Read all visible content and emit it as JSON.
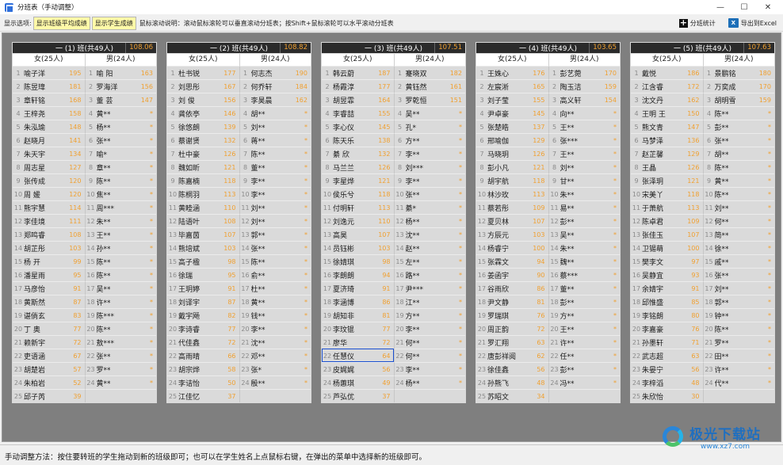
{
  "window": {
    "title": "分班表（手动调整）",
    "buttons": [
      "—",
      "☐",
      "✕"
    ]
  },
  "toolbar": {
    "label": "显示选项:",
    "btn_avg": "显示班级平均成绩",
    "btn_score": "显示学生成绩",
    "tip": "鼠标滚动说明：滚动鼠标滚轮可以垂直滚动分班表；按Shift+鼠标滚轮可以水平滚动分班表",
    "stats_label": "分班统计",
    "export_label": "导出到Excel",
    "excel_icon_text": "X"
  },
  "status": {
    "text": "手动调整方法：按住要转班的学生拖动到新的班级即可；也可以在学生姓名上点鼠标右键，在弹出的菜单中选择新的班级即可。"
  },
  "watermark": {
    "name": "极光下载站",
    "url": "www.xz7.com"
  },
  "colors": {
    "score": "#f0a030",
    "header_bg": "#2b2b2b",
    "selection": "#1a4fd0",
    "button_bg": "#fff9a8"
  },
  "classes": [
    {
      "name": "一 (1) 班(共49人)",
      "avg": "108.06",
      "female_head": "女(25人)",
      "male_head": "男(24人)",
      "rows": [
        {
          "n": "1",
          "f": "喻子洋",
          "fs": "195",
          "m": "喻 阳",
          "ms": "163"
        },
        {
          "n": "2",
          "f": "陈昱瑋",
          "fs": "181",
          "m": "罗海洋",
          "ms": "156"
        },
        {
          "n": "3",
          "f": "章轩铭",
          "fs": "168",
          "m": "董 芸",
          "ms": "147"
        },
        {
          "n": "4",
          "f": "王梓尧",
          "fs": "158",
          "m": "黄**",
          "ms": "*"
        },
        {
          "n": "5",
          "f": "朱泓瑜",
          "fs": "148",
          "m": "杨**",
          "ms": "*"
        },
        {
          "n": "6",
          "f": "赵晓月",
          "fs": "141",
          "m": "张**",
          "ms": "*"
        },
        {
          "n": "7",
          "f": "朱天宇",
          "fs": "134",
          "m": "喻*",
          "ms": "*"
        },
        {
          "n": "8",
          "f": "周志星",
          "fs": "127",
          "m": "章**",
          "ms": "*"
        },
        {
          "n": "9",
          "f": "张传成",
          "fs": "120",
          "m": "陈**",
          "ms": "*"
        },
        {
          "n": "10",
          "f": "周 媛",
          "fs": "120",
          "m": "焦**",
          "ms": "*"
        },
        {
          "n": "11",
          "f": "熊宇慧",
          "fs": "114",
          "m": "周***",
          "ms": "*"
        },
        {
          "n": "12",
          "f": "李佳境",
          "fs": "111",
          "m": "朱**",
          "ms": "*"
        },
        {
          "n": "13",
          "f": "郑鸣睿",
          "fs": "108",
          "m": "王**",
          "ms": "*"
        },
        {
          "n": "14",
          "f": "胡芷彤",
          "fs": "103",
          "m": "孙**",
          "ms": "*"
        },
        {
          "n": "15",
          "f": "杨 开",
          "fs": "99",
          "m": "陈**",
          "ms": "*"
        },
        {
          "n": "16",
          "f": "潘星雨",
          "fs": "95",
          "m": "陈**",
          "ms": "*"
        },
        {
          "n": "17",
          "f": "马彦怡",
          "fs": "91",
          "m": "吴**",
          "ms": "*"
        },
        {
          "n": "18",
          "f": "黄斯然",
          "fs": "87",
          "m": "许**",
          "ms": "*"
        },
        {
          "n": "19",
          "f": "谌倘玄",
          "fs": "83",
          "m": "陈***",
          "ms": "*"
        },
        {
          "n": "20",
          "f": "丁 奥",
          "fs": "77",
          "m": "陈**",
          "ms": "*"
        },
        {
          "n": "21",
          "f": "赖新宇",
          "fs": "72",
          "m": "敖***",
          "ms": "*"
        },
        {
          "n": "22",
          "f": "吏语涵",
          "fs": "67",
          "m": "张**",
          "ms": "*"
        },
        {
          "n": "23",
          "f": "胡楚岩",
          "fs": "57",
          "m": "罗**",
          "ms": "*"
        },
        {
          "n": "24",
          "f": "朱柏岩",
          "fs": "52",
          "m": "黄**",
          "ms": "*"
        },
        {
          "n": "25",
          "f": "邱子芮",
          "fs": "39",
          "m": "",
          "ms": ""
        }
      ]
    },
    {
      "name": "一 (2) 班(共49人)",
      "avg": "108.82",
      "female_head": "女(25人)",
      "male_head": "男(24人)",
      "rows": [
        {
          "n": "1",
          "f": "杜书锐",
          "fs": "177",
          "m": "何志杰",
          "ms": "190"
        },
        {
          "n": "2",
          "f": "刘思彤",
          "fs": "167",
          "m": "何乔轩",
          "ms": "184"
        },
        {
          "n": "3",
          "f": "刘 俊",
          "fs": "156",
          "m": "李昊晨",
          "ms": "162"
        },
        {
          "n": "4",
          "f": "龚依亭",
          "fs": "146",
          "m": "胡**",
          "ms": "*"
        },
        {
          "n": "5",
          "f": "徐悠朗",
          "fs": "139",
          "m": "刘**",
          "ms": "*"
        },
        {
          "n": "6",
          "f": "蔡谢贤",
          "fs": "132",
          "m": "蒋**",
          "ms": "*"
        },
        {
          "n": "7",
          "f": "杜中豪",
          "fs": "126",
          "m": "陈**",
          "ms": "*"
        },
        {
          "n": "8",
          "f": "魏如昕",
          "fs": "121",
          "m": "董**",
          "ms": "*"
        },
        {
          "n": "9",
          "f": "陈嘉楠",
          "fs": "118",
          "m": "李**",
          "ms": "*"
        },
        {
          "n": "10",
          "f": "陈桐羽",
          "fs": "113",
          "m": "李**",
          "ms": "*"
        },
        {
          "n": "11",
          "f": "黄睦涵",
          "fs": "110",
          "m": "刘**",
          "ms": "*"
        },
        {
          "n": "12",
          "f": "陆语叶",
          "fs": "108",
          "m": "刘**",
          "ms": "*"
        },
        {
          "n": "13",
          "f": "毕嘉茵",
          "fs": "107",
          "m": "郭**",
          "ms": "*"
        },
        {
          "n": "14",
          "f": "熊培斌",
          "fs": "103",
          "m": "张**",
          "ms": "*"
        },
        {
          "n": "15",
          "f": "高子楹",
          "fs": "98",
          "m": "陈**",
          "ms": "*"
        },
        {
          "n": "16",
          "f": "徐瑞",
          "fs": "95",
          "m": "俞**",
          "ms": "*"
        },
        {
          "n": "17",
          "f": "王玥婷",
          "fs": "91",
          "m": "杜**",
          "ms": "*"
        },
        {
          "n": "18",
          "f": "刘译宇",
          "fs": "87",
          "m": "黄**",
          "ms": "*"
        },
        {
          "n": "19",
          "f": "戴宇飏",
          "fs": "82",
          "m": "钱**",
          "ms": "*"
        },
        {
          "n": "20",
          "f": "李诗睿",
          "fs": "77",
          "m": "李**",
          "ms": "*"
        },
        {
          "n": "21",
          "f": "代佳鑫",
          "fs": "72",
          "m": "沈**",
          "ms": "*"
        },
        {
          "n": "22",
          "f": "高雨晴",
          "fs": "66",
          "m": "邓**",
          "ms": "*"
        },
        {
          "n": "23",
          "f": "胡宗烨",
          "fs": "58",
          "m": "张*",
          "ms": "*"
        },
        {
          "n": "24",
          "f": "李诘怡",
          "fs": "50",
          "m": "殷**",
          "ms": "*"
        },
        {
          "n": "25",
          "f": "江佳忆",
          "fs": "37",
          "m": "",
          "ms": ""
        }
      ]
    },
    {
      "name": "一 (3) 班(共49人)",
      "avg": "107.51",
      "female_head": "女(25人)",
      "male_head": "男(24人)",
      "rows": [
        {
          "n": "1",
          "f": "韩云蔚",
          "fs": "187",
          "m": "蹇晓双",
          "ms": "182"
        },
        {
          "n": "2",
          "f": "杨霞淳",
          "fs": "177",
          "m": "黄钰然",
          "ms": "161"
        },
        {
          "n": "3",
          "f": "胡昱霏",
          "fs": "164",
          "m": "罗乾恒",
          "ms": "151"
        },
        {
          "n": "4",
          "f": "李睿喆",
          "fs": "155",
          "m": "吴**",
          "ms": "*"
        },
        {
          "n": "5",
          "f": "李心仪",
          "fs": "145",
          "m": "孔*",
          "ms": "*"
        },
        {
          "n": "6",
          "f": "陈天乐",
          "fs": "138",
          "m": "方**",
          "ms": "*"
        },
        {
          "n": "7",
          "f": "綦 欣",
          "fs": "132",
          "m": "李**",
          "ms": "*"
        },
        {
          "n": "8",
          "f": "马兰兰",
          "fs": "126",
          "m": "刘***",
          "ms": "*"
        },
        {
          "n": "9",
          "f": "李星烨",
          "fs": "121",
          "m": "李**",
          "ms": "*"
        },
        {
          "n": "10",
          "f": "侯乐兮",
          "fs": "118",
          "m": "张**",
          "ms": "*"
        },
        {
          "n": "11",
          "f": "付明轩",
          "fs": "113",
          "m": "綦*",
          "ms": "*"
        },
        {
          "n": "12",
          "f": "刘逸元",
          "fs": "110",
          "m": "杨**",
          "ms": "*"
        },
        {
          "n": "13",
          "f": "高昊",
          "fs": "107",
          "m": "沈**",
          "ms": "*"
        },
        {
          "n": "14",
          "f": "员钰彬",
          "fs": "103",
          "m": "赵**",
          "ms": "*"
        },
        {
          "n": "15",
          "f": "徐婧琪",
          "fs": "98",
          "m": "左**",
          "ms": "*"
        },
        {
          "n": "16",
          "f": "李朗朗",
          "fs": "94",
          "m": "路**",
          "ms": "*"
        },
        {
          "n": "17",
          "f": "夏济琦",
          "fs": "91",
          "m": "尹***",
          "ms": "*"
        },
        {
          "n": "18",
          "f": "李涵博",
          "fs": "86",
          "m": "江**",
          "ms": "*"
        },
        {
          "n": "19",
          "f": "胡知非",
          "fs": "81",
          "m": "方**",
          "ms": "*"
        },
        {
          "n": "20",
          "f": "李玟锟",
          "fs": "77",
          "m": "李**",
          "ms": "*"
        },
        {
          "n": "21",
          "f": "廖华",
          "fs": "72",
          "m": "何**",
          "ms": "*"
        },
        {
          "n": "22",
          "f": "任慧仪",
          "fs": "64",
          "m": "何**",
          "ms": "*",
          "sel": true
        },
        {
          "n": "23",
          "f": "皮娓娓",
          "fs": "56",
          "m": "李**",
          "ms": "*"
        },
        {
          "n": "24",
          "f": "杨蕙琪",
          "fs": "49",
          "m": "杨**",
          "ms": "*"
        },
        {
          "n": "25",
          "f": "芦弘优",
          "fs": "37",
          "m": "",
          "ms": ""
        }
      ]
    },
    {
      "name": "一 (4) 班(共49人)",
      "avg": "103.65",
      "female_head": "女(25人)",
      "male_head": "男(24人)",
      "rows": [
        {
          "n": "1",
          "f": "王姝心",
          "fs": "176",
          "m": "彭艺菀",
          "ms": "170"
        },
        {
          "n": "2",
          "f": "左宸淅",
          "fs": "165",
          "m": "陶玉洁",
          "ms": "159"
        },
        {
          "n": "3",
          "f": "刘子莹",
          "fs": "155",
          "m": "高义轩",
          "ms": "154"
        },
        {
          "n": "4",
          "f": "尹卓豪",
          "fs": "145",
          "m": "向**",
          "ms": "*"
        },
        {
          "n": "5",
          "f": "张楚皓",
          "fs": "137",
          "m": "王**",
          "ms": "*"
        },
        {
          "n": "6",
          "f": "邢喻伽",
          "fs": "129",
          "m": "张***",
          "ms": "*"
        },
        {
          "n": "7",
          "f": "马晓玥",
          "fs": "126",
          "m": "王**",
          "ms": "*"
        },
        {
          "n": "8",
          "f": "彭小凡",
          "fs": "121",
          "m": "刘**",
          "ms": "*"
        },
        {
          "n": "9",
          "f": "胡宇航",
          "fs": "118",
          "m": "甘**",
          "ms": "*"
        },
        {
          "n": "10",
          "f": "林沙玫",
          "fs": "113",
          "m": "朱**",
          "ms": "*"
        },
        {
          "n": "11",
          "f": "蔡若彤",
          "fs": "109",
          "m": "易**",
          "ms": "*"
        },
        {
          "n": "12",
          "f": "夏贝林",
          "fs": "107",
          "m": "彭**",
          "ms": "*"
        },
        {
          "n": "13",
          "f": "方辰元",
          "fs": "103",
          "m": "吴**",
          "ms": "*"
        },
        {
          "n": "14",
          "f": "杨睿宁",
          "fs": "100",
          "m": "朱**",
          "ms": "*"
        },
        {
          "n": "15",
          "f": "张霖文",
          "fs": "94",
          "m": "魏**",
          "ms": "*"
        },
        {
          "n": "16",
          "f": "姜函宇",
          "fs": "90",
          "m": "蔡***",
          "ms": "*"
        },
        {
          "n": "17",
          "f": "谷雨欣",
          "fs": "86",
          "m": "董**",
          "ms": "*"
        },
        {
          "n": "18",
          "f": "尹文静",
          "fs": "81",
          "m": "彭**",
          "ms": "*"
        },
        {
          "n": "19",
          "f": "罗瑞琪",
          "fs": "76",
          "m": "方**",
          "ms": "*"
        },
        {
          "n": "20",
          "f": "周正韵",
          "fs": "72",
          "m": "王**",
          "ms": "*"
        },
        {
          "n": "21",
          "f": "罗汇翔",
          "fs": "63",
          "m": "许**",
          "ms": "*"
        },
        {
          "n": "22",
          "f": "唐彭祥阅",
          "fs": "62",
          "m": "任**",
          "ms": "*"
        },
        {
          "n": "23",
          "f": "徐佳鑫",
          "fs": "56",
          "m": "彭**",
          "ms": "*"
        },
        {
          "n": "24",
          "f": "孙熊飞",
          "fs": "48",
          "m": "冯**",
          "ms": "*"
        },
        {
          "n": "25",
          "f": "苏昭文",
          "fs": "34",
          "m": "",
          "ms": ""
        }
      ]
    },
    {
      "name": "一 (5) 班(共49人)",
      "avg": "107.63",
      "female_head": "女(25人)",
      "male_head": "男(24人)",
      "rows": [
        {
          "n": "1",
          "f": "戴悦",
          "fs": "186",
          "m": "景鹏铭",
          "ms": "180"
        },
        {
          "n": "2",
          "f": "江含睿",
          "fs": "172",
          "m": "万奕成",
          "ms": "170"
        },
        {
          "n": "3",
          "f": "沈文丹",
          "fs": "162",
          "m": "胡明雪",
          "ms": "159"
        },
        {
          "n": "4",
          "f": "王明 王",
          "fs": "150",
          "m": "陈**",
          "ms": "*"
        },
        {
          "n": "5",
          "f": "熊文青",
          "fs": "147",
          "m": "彭**",
          "ms": "*"
        },
        {
          "n": "6",
          "f": "马梦泽",
          "fs": "136",
          "m": "张**",
          "ms": "*"
        },
        {
          "n": "7",
          "f": "赵芷馨",
          "fs": "129",
          "m": "胡**",
          "ms": "*"
        },
        {
          "n": "8",
          "f": "王晶",
          "fs": "126",
          "m": "陈**",
          "ms": "*"
        },
        {
          "n": "9",
          "f": "张泽玥",
          "fs": "121",
          "m": "黄**",
          "ms": "*"
        },
        {
          "n": "10",
          "f": "宋美丫",
          "fs": "118",
          "m": "陈**",
          "ms": "*"
        },
        {
          "n": "11",
          "f": "于萧航",
          "fs": "113",
          "m": "刘**",
          "ms": "*"
        },
        {
          "n": "12",
          "f": "陈卓君",
          "fs": "109",
          "m": "何**",
          "ms": "*"
        },
        {
          "n": "13",
          "f": "张佳玉",
          "fs": "107",
          "m": "简**",
          "ms": "*"
        },
        {
          "n": "14",
          "f": "卫锡萌",
          "fs": "100",
          "m": "徐**",
          "ms": "*"
        },
        {
          "n": "15",
          "f": "樊李文",
          "fs": "97",
          "m": "戚**",
          "ms": "*"
        },
        {
          "n": "16",
          "f": "吴静宜",
          "fs": "93",
          "m": "张**",
          "ms": "*"
        },
        {
          "n": "17",
          "f": "余婧宇",
          "fs": "91",
          "m": "刘**",
          "ms": "*"
        },
        {
          "n": "18",
          "f": "邱惟盛",
          "fs": "85",
          "m": "郭**",
          "ms": "*"
        },
        {
          "n": "19",
          "f": "李铭朗",
          "fs": "80",
          "m": "钟**",
          "ms": "*"
        },
        {
          "n": "20",
          "f": "李嘉豪",
          "fs": "76",
          "m": "陈**",
          "ms": "*"
        },
        {
          "n": "21",
          "f": "孙墨轩",
          "fs": "71",
          "m": "罗**",
          "ms": "*"
        },
        {
          "n": "22",
          "f": "武志超",
          "fs": "63",
          "m": "田**",
          "ms": "*"
        },
        {
          "n": "23",
          "f": "朱晏宁",
          "fs": "56",
          "m": "许**",
          "ms": "*"
        },
        {
          "n": "24",
          "f": "李梓滔",
          "fs": "48",
          "m": "代**",
          "ms": "*"
        },
        {
          "n": "25",
          "f": "朱欣怡",
          "fs": "30",
          "m": "",
          "ms": ""
        }
      ]
    }
  ]
}
